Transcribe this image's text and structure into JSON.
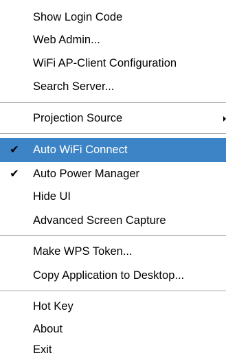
{
  "menu": {
    "highlight_color": "#3d84c6",
    "check_glyph": "✔",
    "items": [
      {
        "label": "Show Login Code"
      },
      {
        "label": "Web Admin..."
      },
      {
        "label": "WiFi AP-Client Configuration"
      },
      {
        "label": "Search Server..."
      },
      {
        "label": "Projection Source"
      },
      {
        "label": "Auto WiFi Connect",
        "checked": true,
        "highlighted": true
      },
      {
        "label": "Auto Power Manager",
        "checked": true
      },
      {
        "label": "Hide UI"
      },
      {
        "label": "Advanced Screen Capture"
      },
      {
        "label": "Make WPS Token..."
      },
      {
        "label": "Copy Application to Desktop..."
      },
      {
        "label": "Hot Key"
      },
      {
        "label": "About"
      },
      {
        "label": "Exit"
      }
    ]
  }
}
